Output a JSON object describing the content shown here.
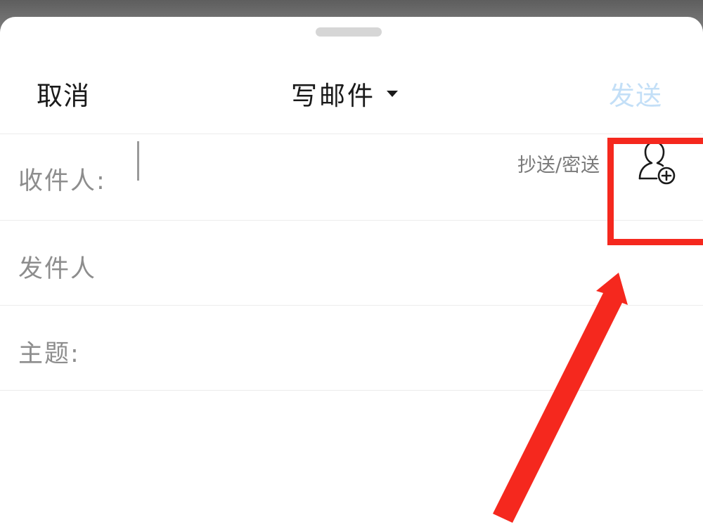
{
  "nav": {
    "cancel_label": "取消",
    "title": "写邮件",
    "send_label": "发送"
  },
  "compose": {
    "to_label": "收件人:",
    "to_value": "",
    "cc_bcc_label": "抄送/密送",
    "from_label": "发件人",
    "from_value": "",
    "subject_label": "主题:",
    "subject_value": "",
    "body_value": ""
  },
  "icons": {
    "add_contact": "person-plus-icon",
    "title_caret": "caret-down-icon",
    "grabber": "sheet-grabber"
  },
  "colors": {
    "send_disabled": "#c3dff7",
    "label_gray": "#8d8d8d",
    "annotation_red": "#f5281e"
  }
}
